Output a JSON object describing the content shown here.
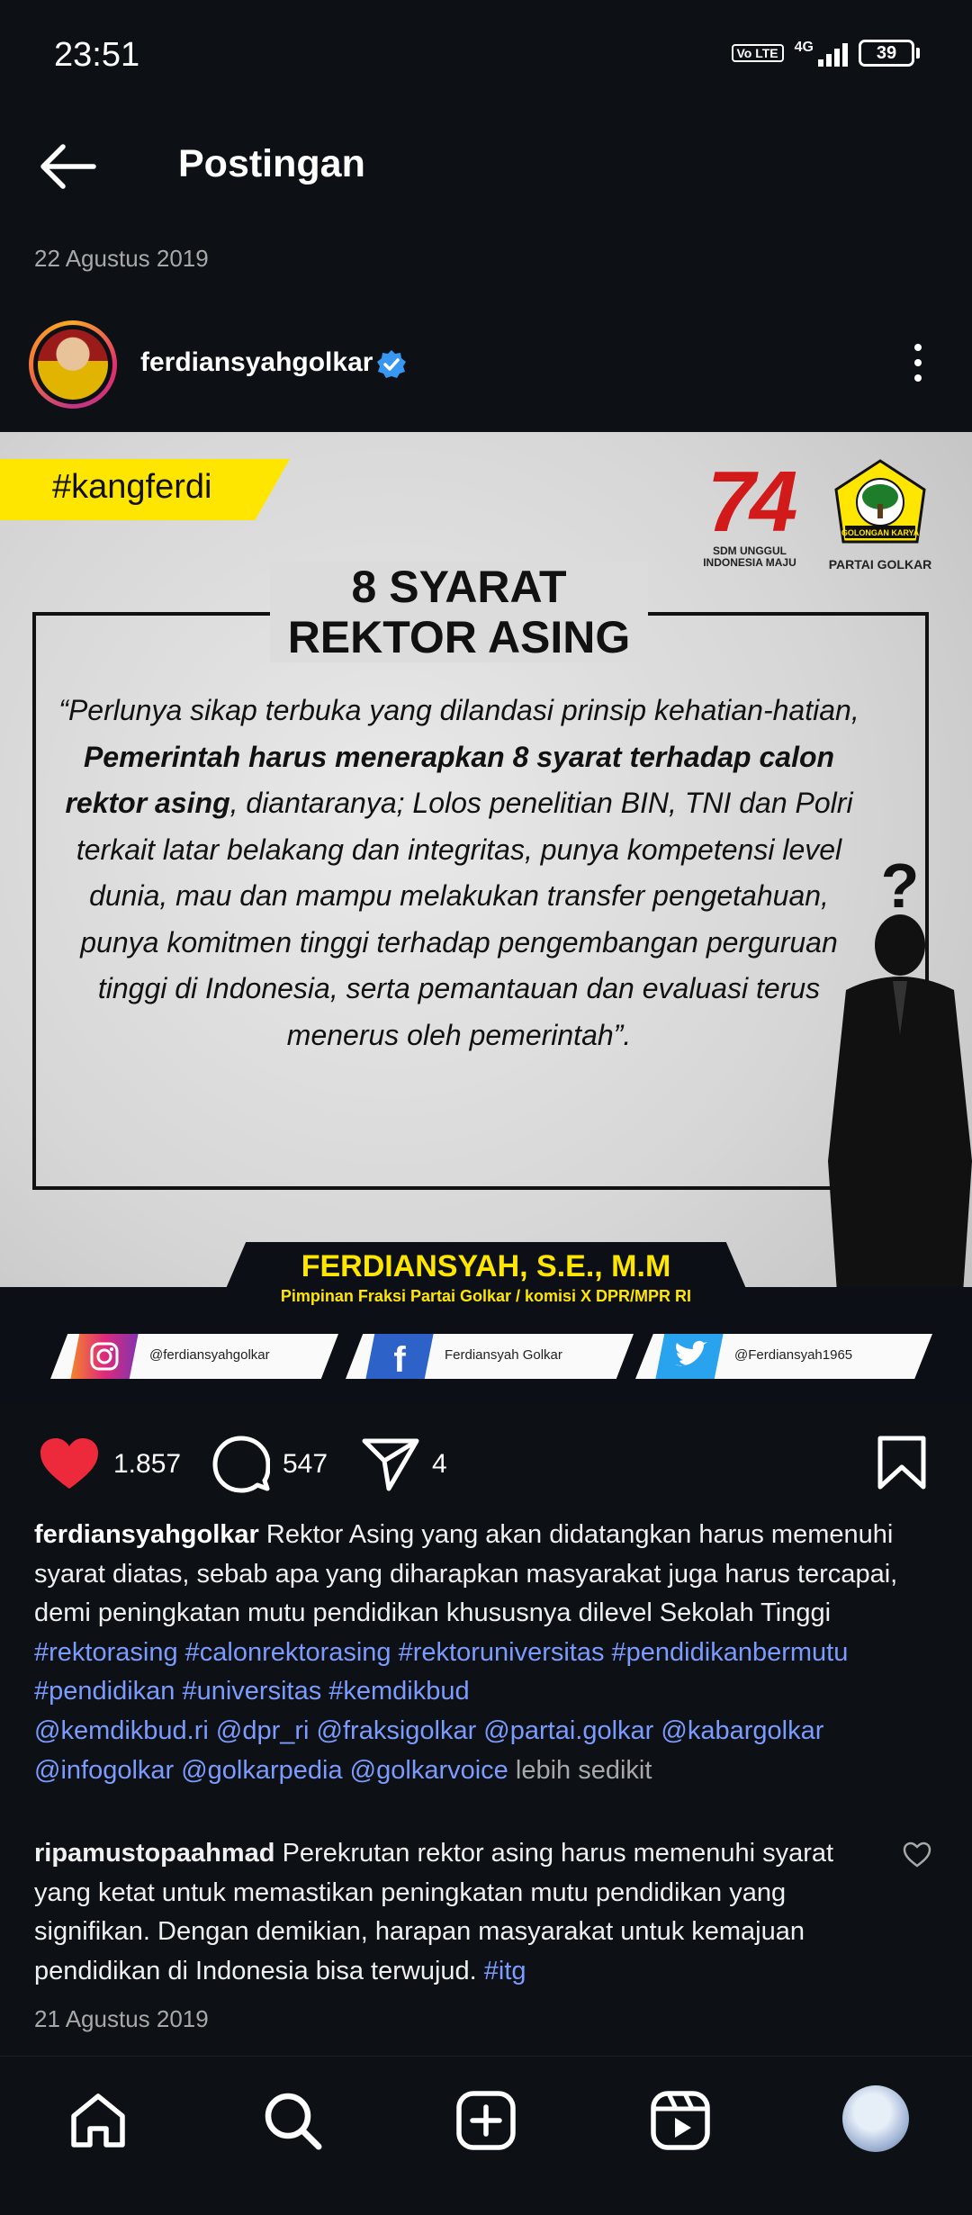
{
  "status_bar": {
    "time": "23:51",
    "volte": "Vo LTE",
    "network": "4G",
    "battery": "39"
  },
  "header": {
    "title": "Postingan"
  },
  "post_date": "22 Agustus 2019",
  "author": {
    "username": "ferdiansyahgolkar",
    "verified_icon": "verified-badge-icon"
  },
  "post_image": {
    "hashtag": "#kangferdi",
    "logo_74_caption_line1": "SDM UNGGUL",
    "logo_74_caption_line2": "INDONESIA MAJU",
    "logo_74_number": "74",
    "golkar_badge": "GOLONGAN KARYA",
    "golkar_caption": "PARTAI GOLKAR",
    "title_line1": "8 SYARAT",
    "title_line2": "REKTOR ASING",
    "quote_part1": "“Perlunya sikap terbuka yang dilandasi prinsip kehatian-hatian, ",
    "quote_bold": "Pemerintah  harus menerapkan 8 syarat terhadap calon rektor asing",
    "quote_part2": ", diantaranya; Lolos penelitian BIN, TNI dan Polri terkait latar belakang dan integritas, punya kompetensi level dunia, mau dan mampu melakukan transfer pengetahuan, punya komitmen tinggi terhadap pengembangan perguruan tinggi di Indonesia, serta  pemantauan dan evaluasi terus menerus oleh pemerintah”.",
    "name": "FERDIANSYAH, S.E., M.M",
    "position": "Pimpinan Fraksi Partai Golkar / komisi X DPR/MPR RI",
    "social_instagram": "@ferdiansyahgolkar",
    "social_facebook": "Ferdiansyah Golkar",
    "social_twitter": "@Ferdiansyah1965"
  },
  "actions": {
    "likes": "1.857",
    "comments": "547",
    "shares": "4"
  },
  "caption": {
    "username": "ferdiansyahgolkar",
    "text": "Rektor Asing yang akan didatangkan harus memenuhi syarat diatas, sebab apa yang diharapkan masyarakat juga harus tercapai, demi peningkatan mutu pendidikan khususnya dilevel Sekolah Tinggi",
    "hashtags": "#rektorasing #calonrektorasing #rektoruniversitas #pendidikanbermutu #pendidikan #universitas #kemdikbud",
    "mentions": "@kemdikbud.ri @dpr_ri @fraksigolkar @partai.golkar @kabargolkar @infogolkar @golkarpedia @golkarvoice",
    "less": "lebih sedikit"
  },
  "comment": {
    "username": "ripamustopaahmad",
    "text": "Perekrutan rektor asing harus memenuhi syarat yang ketat untuk memastikan peningkatan mutu pendidikan yang signifikan. Dengan demikian, harapan masyarakat untuk kemajuan pendidikan di Indonesia bisa terwujud.",
    "tag": "#itg"
  },
  "comment_date": "21 Agustus 2019",
  "colors": {
    "background": "#0d1014",
    "link": "#7b9bff",
    "like": "#ed2a3b",
    "banner_yellow": "#ffe600"
  }
}
